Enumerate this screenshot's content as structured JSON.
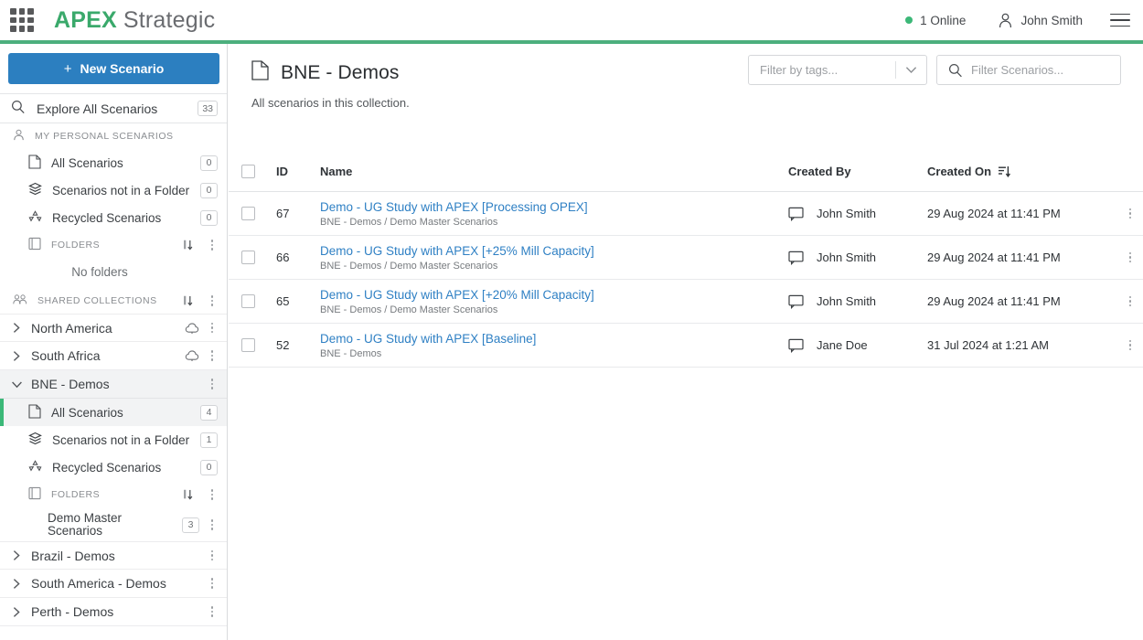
{
  "topbar": {
    "apps_icon": "grid-icon",
    "brand_primary": "APEX",
    "brand_secondary": "Strategic",
    "online_label": "1 Online",
    "user_name": "John Smith",
    "menu_icon": "hamburger-icon",
    "accent_color": "#4caf7d"
  },
  "sidebar": {
    "new_scenario_label": "New Scenario",
    "new_scenario_plus": "+",
    "explore": {
      "label": "Explore All Scenarios",
      "count": "33"
    },
    "personal": {
      "section_label": "MY PERSONAL SCENARIOS",
      "items": [
        {
          "label": "All Scenarios",
          "count": "0",
          "icon": "document-icon"
        },
        {
          "label": "Scenarios not in a Folder",
          "count": "0",
          "icon": "layers-icon"
        },
        {
          "label": "Recycled Scenarios",
          "count": "0",
          "icon": "recycle-icon"
        }
      ],
      "folders_label": "FOLDERS",
      "no_folders_label": "No folders"
    },
    "shared": {
      "section_label": "SHARED COLLECTIONS",
      "collections": [
        {
          "label": "North America",
          "expanded": false,
          "cloud": true
        },
        {
          "label": "South Africa",
          "expanded": false,
          "cloud": true
        },
        {
          "label": "BNE - Demos",
          "expanded": true,
          "cloud": false
        }
      ],
      "bne_items": [
        {
          "label": "All Scenarios",
          "count": "4",
          "icon": "document-icon",
          "active": true
        },
        {
          "label": "Scenarios not in a Folder",
          "count": "1",
          "icon": "layers-icon",
          "active": false
        },
        {
          "label": "Recycled Scenarios",
          "count": "0",
          "icon": "recycle-icon",
          "active": false
        }
      ],
      "bne_folders_label": "FOLDERS",
      "bne_folder": {
        "label": "Demo Master Scenarios",
        "count": "3"
      },
      "more_collections": [
        {
          "label": "Brazil - Demos"
        },
        {
          "label": "South America - Demos"
        },
        {
          "label": "Perth - Demos"
        }
      ]
    }
  },
  "main": {
    "page_icon": "document-icon",
    "page_title": "BNE - Demos",
    "page_subtitle": "All scenarios in this collection.",
    "tag_filter_placeholder": "Filter by tags...",
    "search_placeholder": "Filter Scenarios...",
    "search_value": "",
    "table": {
      "headers": {
        "id": "ID",
        "name": "Name",
        "created_by": "Created By",
        "created_on": "Created On"
      },
      "sort_column": "Created On",
      "rows": [
        {
          "id": "67",
          "name": "Demo - UG Study with APEX [Processing OPEX]",
          "path": "BNE - Demos / Demo Master Scenarios",
          "created_by": "John Smith",
          "created_on": "29 Aug 2024 at 11:41 PM"
        },
        {
          "id": "66",
          "name": "Demo - UG Study with APEX [+25% Mill Capacity]",
          "path": "BNE - Demos / Demo Master Scenarios",
          "created_by": "John Smith",
          "created_on": "29 Aug 2024 at 11:41 PM"
        },
        {
          "id": "65",
          "name": "Demo - UG Study with APEX [+20% Mill Capacity]",
          "path": "BNE - Demos / Demo Master Scenarios",
          "created_by": "John Smith",
          "created_on": "29 Aug 2024 at 11:41 PM"
        },
        {
          "id": "52",
          "name": "Demo - UG Study with APEX [Baseline]",
          "path": "BNE - Demos",
          "created_by": "Jane Doe",
          "created_on": "31 Jul 2024 at 1:21 AM"
        }
      ]
    }
  },
  "colors": {
    "brand_green": "#3aa96b",
    "accent_bar": "#4caf7d",
    "primary_blue": "#2c7fc0",
    "link_blue": "#2f80c4",
    "active_marker": "#3cb878"
  }
}
